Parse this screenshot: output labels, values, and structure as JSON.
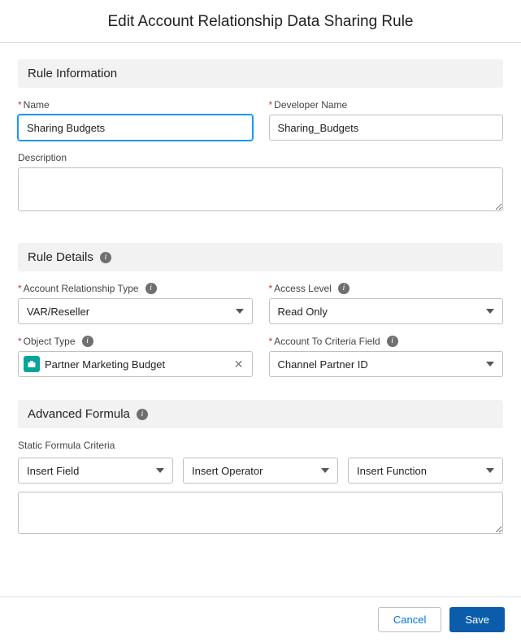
{
  "header": {
    "title": "Edit Account Relationship Data Sharing Rule"
  },
  "sections": {
    "rule_info": {
      "title": "Rule Information",
      "name_label": "Name",
      "name_value": "Sharing Budgets",
      "dev_name_label": "Developer Name",
      "dev_name_value": "Sharing_Budgets",
      "description_label": "Description",
      "description_value": ""
    },
    "rule_details": {
      "title": "Rule Details",
      "acct_rel_type_label": "Account Relationship Type",
      "acct_rel_type_value": "VAR/Reseller",
      "access_level_label": "Access Level",
      "access_level_value": "Read Only",
      "object_type_label": "Object Type",
      "object_type_value": "Partner Marketing Budget",
      "acct_criteria_label": "Account To Criteria Field",
      "acct_criteria_value": "Channel Partner ID"
    },
    "advanced": {
      "title": "Advanced Formula",
      "static_label": "Static Formula Criteria",
      "insert_field": "Insert Field",
      "insert_operator": "Insert Operator",
      "insert_function": "Insert Function",
      "formula_value": ""
    }
  },
  "footer": {
    "cancel": "Cancel",
    "save": "Save"
  },
  "icons": {
    "info": "i"
  }
}
